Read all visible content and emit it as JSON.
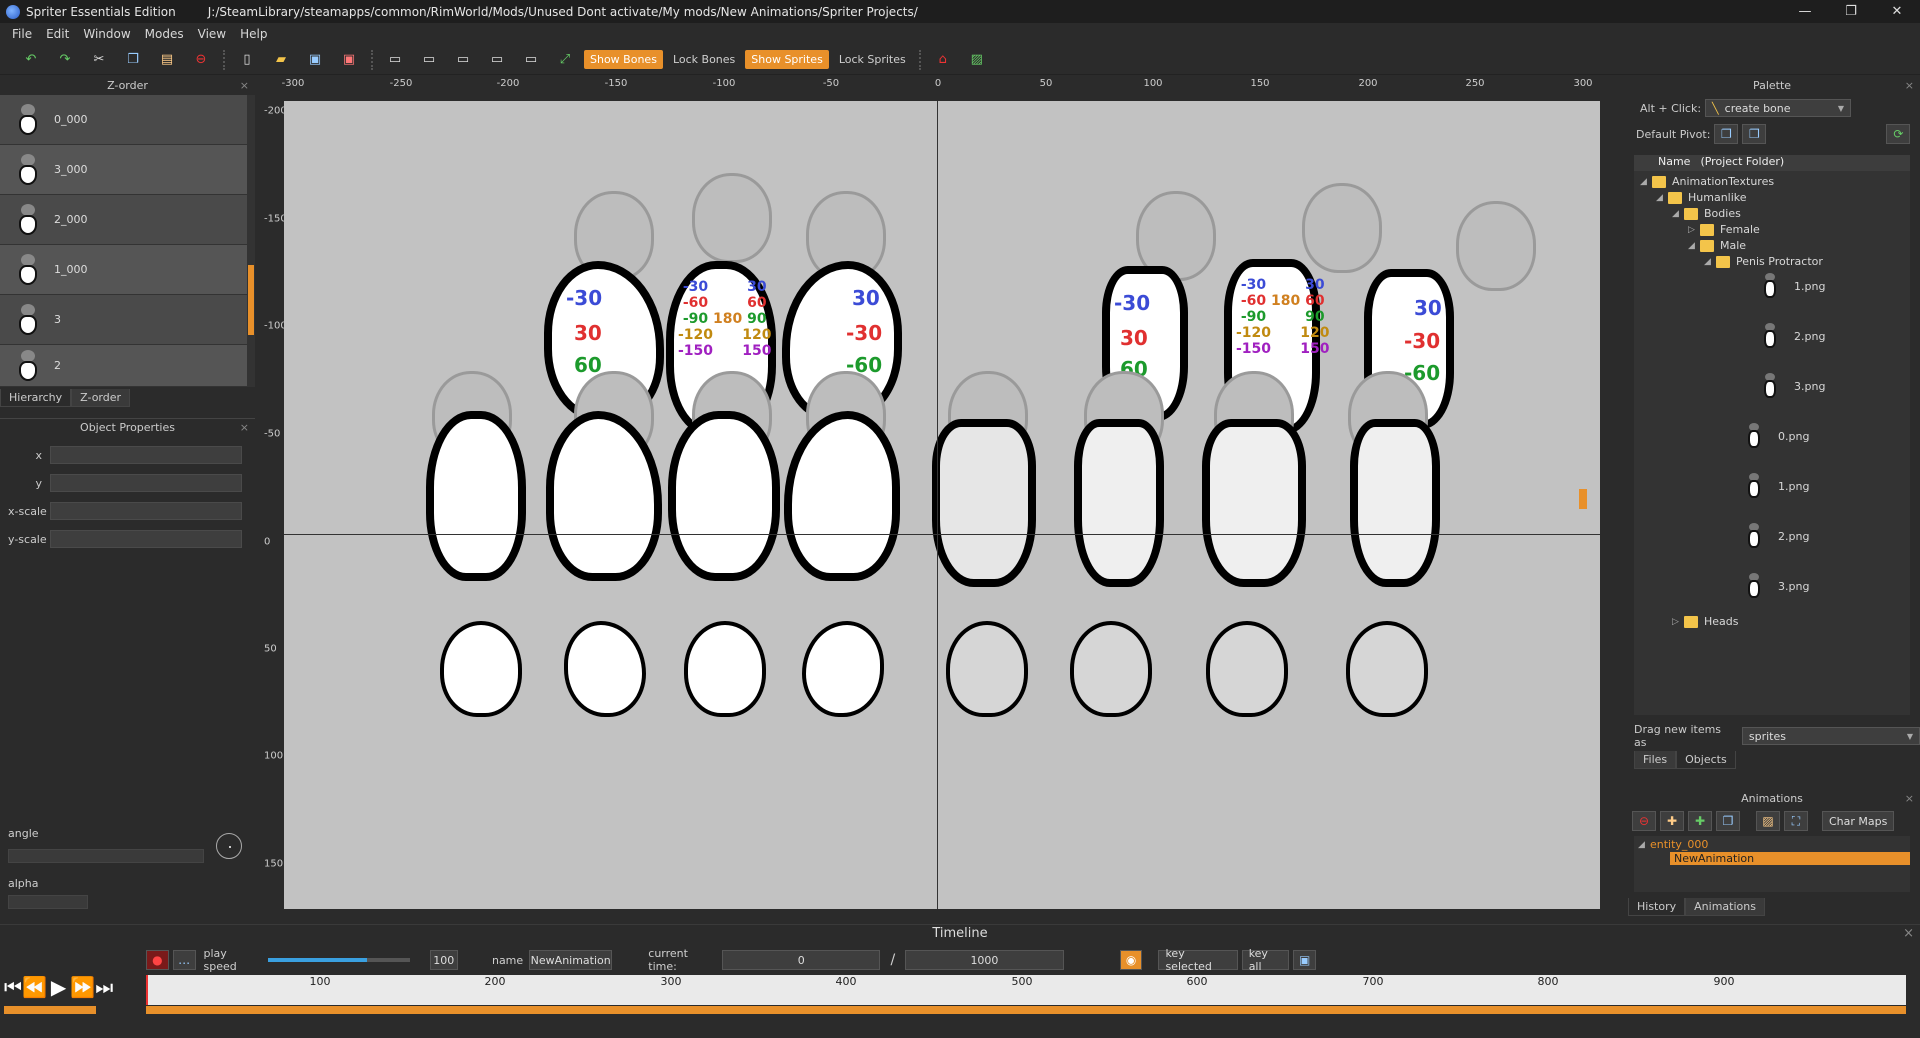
{
  "window": {
    "app_title": "Spriter Essentials Edition",
    "path": "J:/SteamLibrary/steamapps/common/RimWorld/Mods/Unused Dont activate/My mods/New Animations/Spriter Projects/",
    "controls": [
      "—",
      "❐",
      "✕"
    ]
  },
  "menu": [
    "File",
    "Edit",
    "Window",
    "Modes",
    "View",
    "Help"
  ],
  "toolbar": {
    "show_bones": "Show Bones",
    "lock_bones": "Lock Bones",
    "show_sprites": "Show Sprites",
    "lock_sprites": "Lock Sprites"
  },
  "zorder": {
    "title": "Z-order",
    "items": [
      "0_000",
      "3_000",
      "2_000",
      "1_000",
      "3",
      "2"
    ],
    "tabs": [
      "Hierarchy",
      "Z-order"
    ]
  },
  "object_properties": {
    "title": "Object Properties",
    "fields": [
      "x",
      "y",
      "x-scale",
      "y-scale"
    ],
    "angle_label": "angle",
    "alpha_label": "alpha"
  },
  "rulers": {
    "x_ticks": [
      "-300",
      "-250",
      "-200",
      "-150",
      "-100",
      "-50",
      "0",
      "50",
      "100",
      "150",
      "200",
      "250",
      "300"
    ],
    "y_ticks": [
      "-200",
      "-150",
      "-100",
      "-50",
      "0",
      "50",
      "100",
      "150"
    ]
  },
  "canvas_labels": {
    "l1": [
      "-30",
      "30",
      "60"
    ],
    "l2": [
      "30",
      "-30",
      "-60"
    ],
    "grid_left": [
      "-30",
      "30",
      "-60",
      "60",
      "-90",
      "180",
      "90",
      "-120",
      "120",
      "-150",
      "150"
    ],
    "grid_right": [
      "-30",
      "30",
      "-60",
      "180",
      "60",
      "-90",
      "90",
      "-120",
      "120",
      "-150",
      "150"
    ]
  },
  "palette": {
    "title": "Palette",
    "alt_click_label": "Alt + Click:",
    "alt_click_value": "create bone",
    "default_pivot_label": "Default Pivot:",
    "col_name": "Name",
    "col_folder": "(Project Folder)",
    "tree": {
      "animation_textures": "AnimationTextures",
      "humanlike": "Humanlike",
      "bodies": "Bodies",
      "female": "Female",
      "male": "Male",
      "penis_protractor": "Penis Protractor",
      "pp_files": [
        "1.png",
        "2.png",
        "3.png"
      ],
      "male_files": [
        "0.png",
        "1.png",
        "2.png",
        "3.png"
      ],
      "heads": "Heads"
    },
    "drag_label": "Drag new items as",
    "drag_value": "sprites",
    "tabs": [
      "Files",
      "Objects"
    ]
  },
  "animations": {
    "title": "Animations",
    "char_maps": "Char Maps",
    "entity": "entity_000",
    "animation": "NewAnimation",
    "tabs": [
      "History",
      "Animations"
    ]
  },
  "timeline": {
    "title": "Timeline",
    "play_speed_label": "play speed",
    "play_speed_value": "100",
    "play_speed_fraction": 0.7,
    "name_label": "name",
    "name_value": "NewAnimation",
    "current_time_label": "current time:",
    "current_time": "0",
    "separator": "/",
    "length": "1000",
    "key_selected": "key selected",
    "key_all": "key all",
    "ticks": [
      "100",
      "200",
      "300",
      "400",
      "500",
      "600",
      "700",
      "800",
      "900"
    ]
  },
  "colors": {
    "accent": "#e8902a",
    "bg": "#2b2b2b",
    "stage": "#c2c2c2"
  }
}
